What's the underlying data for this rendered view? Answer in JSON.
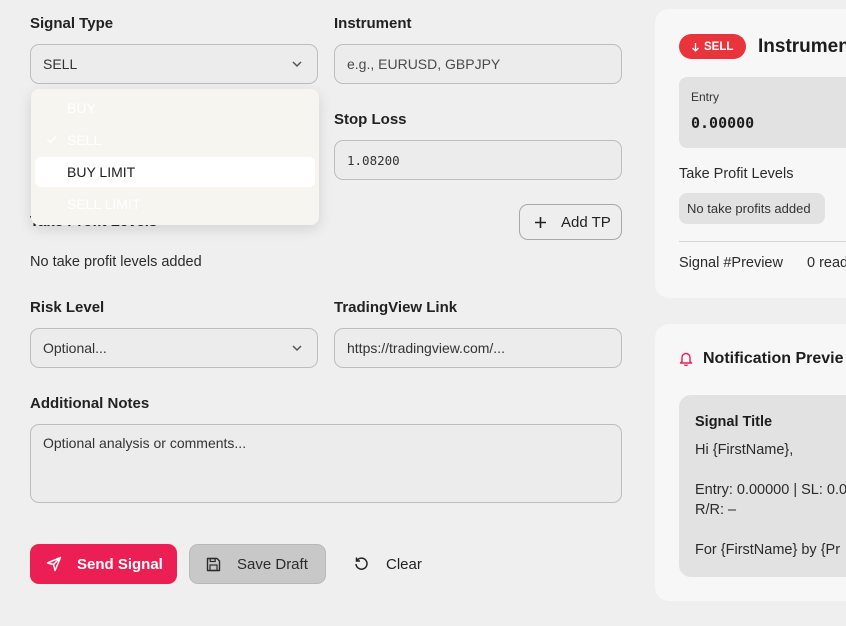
{
  "form": {
    "signal_type": {
      "label": "Signal Type",
      "value": "SELL"
    },
    "instrument": {
      "label": "Instrument",
      "placeholder": "e.g., EURUSD, GBPJPY"
    },
    "stop_loss": {
      "label": "Stop Loss",
      "value": "1.08200"
    },
    "take_profit": {
      "label": "Take Profit Levels",
      "add_label": "Add TP",
      "empty_text": "No take profit levels added"
    },
    "risk_level": {
      "label": "Risk Level",
      "value": "Optional..."
    },
    "tradingview": {
      "label": "TradingView Link",
      "placeholder": "https://tradingview.com/..."
    },
    "notes": {
      "label": "Additional Notes",
      "placeholder": "Optional analysis or comments..."
    },
    "dropdown_options": [
      {
        "label": "BUY",
        "selected": false,
        "highlighted": false
      },
      {
        "label": "SELL",
        "selected": true,
        "highlighted": false
      },
      {
        "label": "BUY LIMIT",
        "selected": false,
        "highlighted": true
      },
      {
        "label": "SELL LIMIT",
        "selected": false,
        "highlighted": false
      }
    ],
    "actions": {
      "send": "Send Signal",
      "draft": "Save Draft",
      "clear": "Clear"
    }
  },
  "preview": {
    "badge": "SELL",
    "instrument_title": "Instrumen",
    "entry_label": "Entry",
    "entry_value": "0.00000",
    "tp_label": "Take Profit Levels",
    "tp_empty": "No take profits added",
    "footer_id": "Signal #Preview",
    "footer_reads": "0 read"
  },
  "notification": {
    "title": "Notification Previe",
    "signal_title": "Signal Title",
    "line1": "Hi {FirstName},",
    "line2": "Entry: 0.00000 | SL: 0.0",
    "line3": "R/R: –",
    "line4": "For {FirstName} by {Pr"
  },
  "colors": {
    "accent": "#ec1f54",
    "badge": "#e8343a"
  }
}
